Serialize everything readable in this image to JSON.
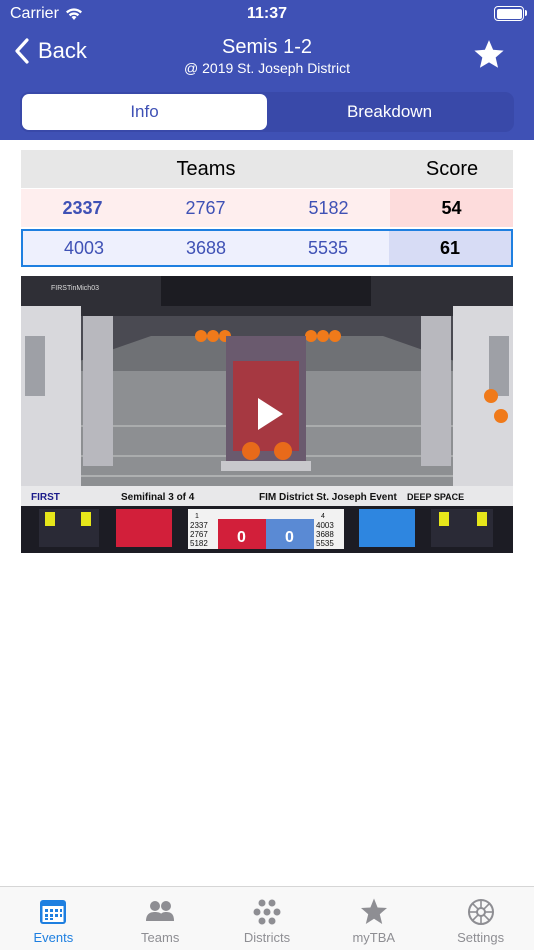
{
  "status": {
    "carrier": "Carrier",
    "time": "11:37"
  },
  "nav": {
    "back_label": "Back",
    "title": "Semis 1-2",
    "subtitle": "@ 2019 St. Joseph District"
  },
  "segments": [
    {
      "label": "Info",
      "active": true
    },
    {
      "label": "Breakdown",
      "active": false
    }
  ],
  "table": {
    "teams_header": "Teams",
    "score_header": "Score",
    "red": {
      "teams": [
        "2337",
        "2767",
        "5182"
      ],
      "score": "54"
    },
    "blue": {
      "teams": [
        "4003",
        "3688",
        "5535"
      ],
      "score": "61"
    }
  },
  "video": {
    "channel": "FIRSTinMich03",
    "match_label": "Semifinal 3 of 4",
    "event_label": "FIM District St. Joseph Event",
    "game_logo": "DEEP SPACE",
    "brand_logo": "FIRST",
    "red_score": "0",
    "blue_score": "0",
    "red_seed": "1",
    "blue_seed": "4",
    "red_teams": [
      "2337",
      "2767",
      "5182"
    ],
    "blue_teams": [
      "4003",
      "3688",
      "5535"
    ]
  },
  "tabs": [
    {
      "label": "Events",
      "icon": "calendar-icon",
      "active": true
    },
    {
      "label": "Teams",
      "icon": "people-icon",
      "active": false
    },
    {
      "label": "Districts",
      "icon": "dots-cluster-icon",
      "active": false
    },
    {
      "label": "myTBA",
      "icon": "star-icon",
      "active": false
    },
    {
      "label": "Settings",
      "icon": "gear-icon",
      "active": false
    }
  ],
  "colors": {
    "primary": "#3f51b5",
    "red_alliance": "#fddcdc",
    "blue_alliance": "#d7dcf5",
    "tab_active": "#1e7fe0",
    "tab_inactive": "#8e8e93"
  }
}
